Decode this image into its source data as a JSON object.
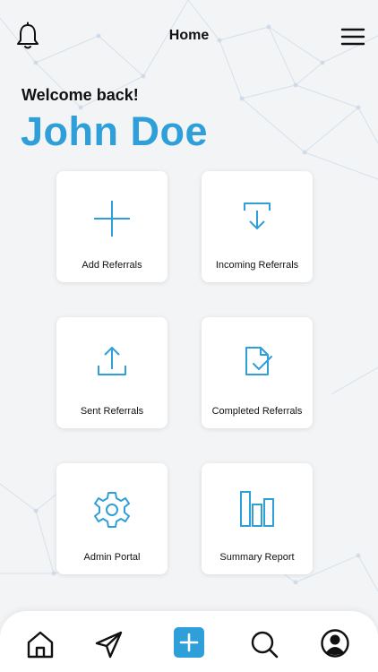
{
  "header": {
    "title": "Home",
    "notification_icon": "bell-icon",
    "menu_icon": "hamburger-menu-icon"
  },
  "greeting": {
    "welcome_text": "Welcome back!",
    "user_name": "John Doe"
  },
  "tiles": [
    {
      "label": "Add Referrals",
      "icon": "plus-icon"
    },
    {
      "label": "Incoming Referrals",
      "icon": "inbox-download-icon"
    },
    {
      "label": "Sent Referrals",
      "icon": "upload-icon"
    },
    {
      "label": "Completed Referrals",
      "icon": "document-check-icon"
    },
    {
      "label": "Admin Portal",
      "icon": "gear-icon"
    },
    {
      "label": "Summary Report",
      "icon": "bar-chart-icon"
    }
  ],
  "bottom_nav": [
    {
      "icon": "home-icon"
    },
    {
      "icon": "send-icon"
    },
    {
      "icon": "add-icon"
    },
    {
      "icon": "search-icon"
    },
    {
      "icon": "profile-icon"
    }
  ],
  "colors": {
    "accent": "#2e9fd9",
    "background": "#f3f4f6",
    "tile": "#ffffff",
    "text": "#111111"
  }
}
